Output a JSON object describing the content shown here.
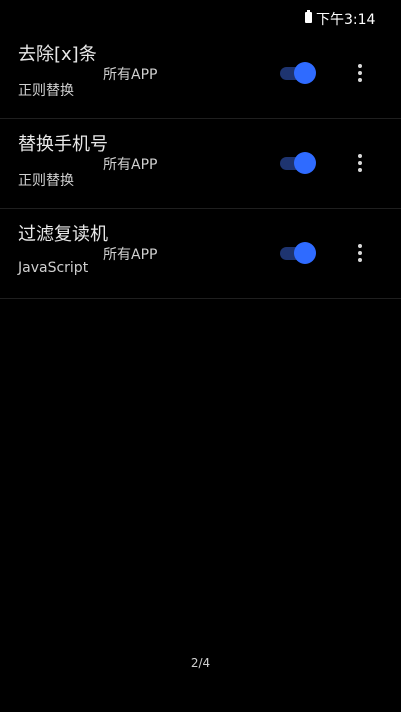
{
  "status_bar": {
    "time": "下午3:14",
    "battery_icon": "battery-icon"
  },
  "rules": [
    {
      "title": "去除[x]条",
      "scope": "所有APP",
      "type": "正则替换",
      "enabled": true
    },
    {
      "title": "替换手机号",
      "scope": "所有APP",
      "type": "正则替换",
      "enabled": true
    },
    {
      "title": "过滤复读机",
      "scope": "所有APP",
      "type": "JavaScript",
      "enabled": true
    }
  ],
  "pager": {
    "text": "2/4"
  },
  "colors": {
    "background": "#000000",
    "toggle_thumb": "#2f6bff",
    "toggle_track": "#1e3470",
    "divider": "#1f1f1f"
  },
  "icons": {
    "toggle": "toggle-switch",
    "more": "more-vert-icon"
  }
}
